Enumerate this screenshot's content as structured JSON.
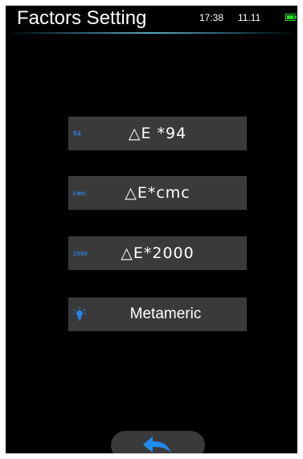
{
  "header": {
    "title": "Factors Setting",
    "time": "17:38",
    "date": "11.11",
    "battery_color": "#22dd22"
  },
  "menu": {
    "items": [
      {
        "tag": "94",
        "label": "△E *94",
        "icon": "de94-tag-icon"
      },
      {
        "tag": "cmc",
        "label": "△E*cmc",
        "icon": "cmc-tag-icon"
      },
      {
        "tag": "2000",
        "label": "△E*2000",
        "icon": "de2000-tag-icon"
      },
      {
        "tag": "",
        "label": "Metameric",
        "icon": "lightbulb-icon"
      }
    ]
  },
  "back": {
    "icon": "back-arrow-icon",
    "color": "#1e8cf0"
  },
  "colors": {
    "accent": "#2a82e0",
    "button_bg": "#3a3a3a",
    "screen_bg": "#000000"
  }
}
